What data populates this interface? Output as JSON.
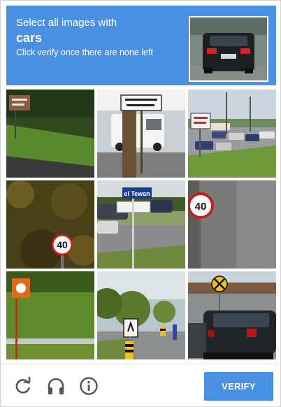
{
  "challenge": {
    "instruction": "Select all images with",
    "target": "cars",
    "hint": "Click verify once there are none left"
  },
  "tiles": [
    {
      "row": 1,
      "col": 1,
      "subject": "grass hill with building sign"
    },
    {
      "row": 1,
      "col": 2,
      "subject": "tree trunk and street sign with white van",
      "sign_text": "INTERDIT SAUF AUX TAXIS"
    },
    {
      "row": 1,
      "col": 3,
      "subject": "used car lot with parked cars",
      "sign_text": "Used Cars"
    },
    {
      "row": 2,
      "col": 1,
      "subject": "speed limit sign in foliage",
      "sign_text": "40"
    },
    {
      "row": 2,
      "col": 2,
      "subject": "street name sign with parked cars",
      "sign_text": "el Tewannon"
    },
    {
      "row": 2,
      "col": 3,
      "subject": "speed limit sign close-up",
      "sign_text": "40"
    },
    {
      "row": 3,
      "col": 1,
      "subject": "orange sign with guard rail and grass"
    },
    {
      "row": 3,
      "col": 2,
      "subject": "road with traffic signs and trees"
    },
    {
      "row": 3,
      "col": 3,
      "subject": "rear of dark SUV with railroad crossing sign"
    }
  ],
  "footer": {
    "reload_icon": "reload-icon",
    "audio_icon": "headphones-icon",
    "info_icon": "info-icon",
    "verify_label": "VERIFY"
  },
  "colors": {
    "accent": "#4a90e2",
    "icon_gray": "#555555"
  }
}
